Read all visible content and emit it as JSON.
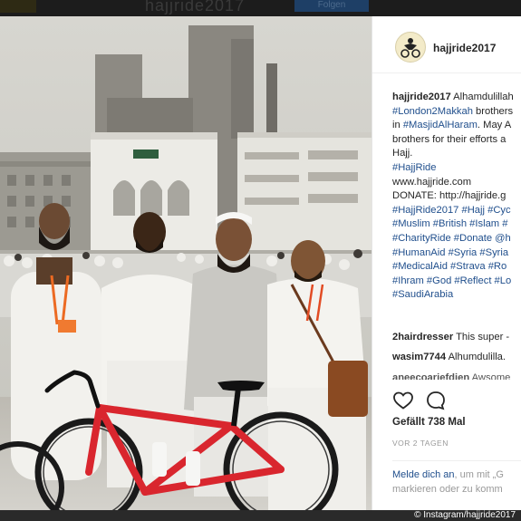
{
  "top_bar": {
    "blurred_title": "hajjride2017",
    "blurred_button": "Folgen"
  },
  "post": {
    "username": "hajjride2017",
    "caption_lines": [
      [
        {
          "t": "hajjride2017",
          "k": "u"
        },
        {
          "t": " Alhamdulillah",
          "k": "n"
        }
      ],
      [
        {
          "t": "#London2Makkah",
          "k": "h"
        },
        {
          "t": " brothers",
          "k": "n"
        }
      ],
      [
        {
          "t": "in ",
          "k": "n"
        },
        {
          "t": "#MasjidAlHaram",
          "k": "h"
        },
        {
          "t": ". May A",
          "k": "n"
        }
      ],
      [
        {
          "t": "brothers for their efforts a",
          "k": "n"
        }
      ],
      [
        {
          "t": "Hajj.",
          "k": "n"
        }
      ],
      [
        {
          "t": "#HajjRide",
          "k": "h"
        }
      ],
      [
        {
          "t": "www.hajjride.com",
          "k": "n"
        }
      ],
      [
        {
          "t": "DONATE: http://hajjride.g",
          "k": "n"
        }
      ],
      [
        {
          "t": " ",
          "k": "n"
        }
      ],
      [
        {
          "t": "#HajjRide2017 #Hajj #Cyc",
          "k": "h"
        }
      ],
      [
        {
          "t": "#Muslim #British #Islam #",
          "k": "h"
        }
      ],
      [
        {
          "t": "#CharityRide",
          "k": "h"
        },
        {
          "t": " #Donate @h",
          "k": "h"
        }
      ],
      [
        {
          "t": "#HumanAid #Syria #Syria",
          "k": "h"
        }
      ],
      [
        {
          "t": "#MedicalAid #Strava #Ro",
          "k": "h"
        }
      ],
      [
        {
          "t": "#Ihram #God #Reflect #Lo",
          "k": "h"
        }
      ],
      [
        {
          "t": "#SaudiArabia",
          "k": "h"
        }
      ]
    ],
    "comments": [
      {
        "user": "2hairdresser",
        "text": " This super -"
      },
      {
        "user": "wasim7744",
        "text": " Alhumdulilla."
      },
      {
        "user": "aneecoariefdien",
        "text": " Awsome"
      }
    ],
    "likes": "Gefällt 738 Mal",
    "time_ago": "VOR 2 TAGEN",
    "login_prompt": {
      "link": "Melde dich an",
      "text_1": ", um mit „G",
      "text_2": "markieren oder zu komm"
    }
  },
  "credit": "© Instagram/hajjride2017",
  "icons": [
    "heart-icon",
    "comment-icon"
  ],
  "colors": {
    "link": "#1f4e8c",
    "text": "#262626",
    "muted": "#999999",
    "bike_frame": "#d9262e"
  }
}
